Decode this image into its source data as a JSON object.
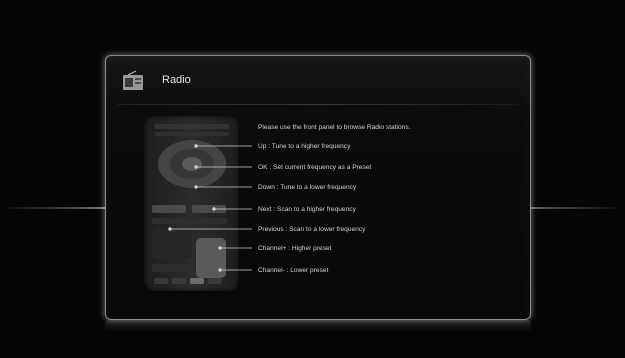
{
  "panel": {
    "title": "Radio",
    "icon": "radio-icon"
  },
  "instructions": {
    "intro": "Please use the front panel to browse Radio stations.",
    "items": [
      "Up : Tune to a higher frequency",
      "OK : Set current frequency as a Preset",
      "Down : Tune to a lower frequency",
      "Next : Scan to a higher frequency",
      "Previous : Scan to a lower frequency",
      "Channel+ : Higher preset",
      "Channel- : Lower preset"
    ]
  },
  "colors": {
    "background": "#000000",
    "panel_border": "#8a8a8a",
    "text": "#d2d2d2"
  }
}
